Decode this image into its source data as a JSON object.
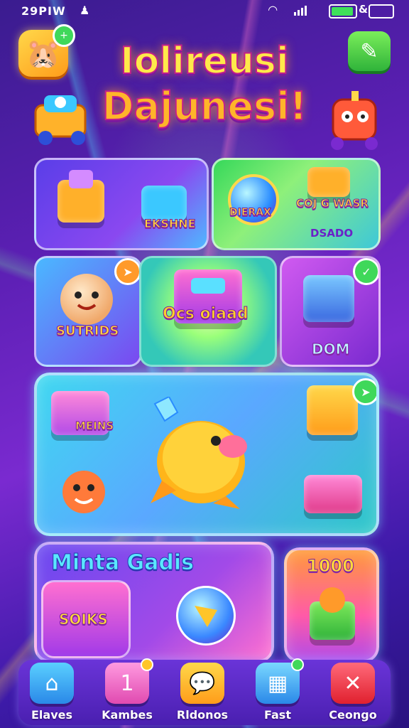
{
  "status_bar": {
    "time": "29PIW"
  },
  "header": {
    "title_line1": "Iolireusi",
    "title_line2": "Dajunesi!"
  },
  "tiles": {
    "top_left_label": "EKSHNE",
    "top_right_label_1": "DIERAX",
    "top_right_label_2": "COJ G WASR",
    "top_right_label_3": "DSADO",
    "mid_left_label": "SUTRIDS",
    "mid_center_label": "Ocs oiaad",
    "mid_right_label": "DOM",
    "big_panel_label": "MEINS",
    "bottom_left_title": "Minta Gadis",
    "bottom_left_sub": "SOIKS",
    "bottom_right_value": "1000"
  },
  "nav": [
    {
      "label": "Elaves",
      "icon": "home-icon",
      "color": "#2aa8f0"
    },
    {
      "label": "Kambes",
      "icon": "trophy-icon",
      "color": "#ff6fd0"
    },
    {
      "label": "Rldonos",
      "icon": "chat-icon",
      "color": "#ffb62a"
    },
    {
      "label": "Fast",
      "icon": "gift-icon",
      "color": "#37b8ff"
    },
    {
      "label": "Ceongo",
      "icon": "close-icon",
      "color": "#ff3b4a"
    }
  ]
}
